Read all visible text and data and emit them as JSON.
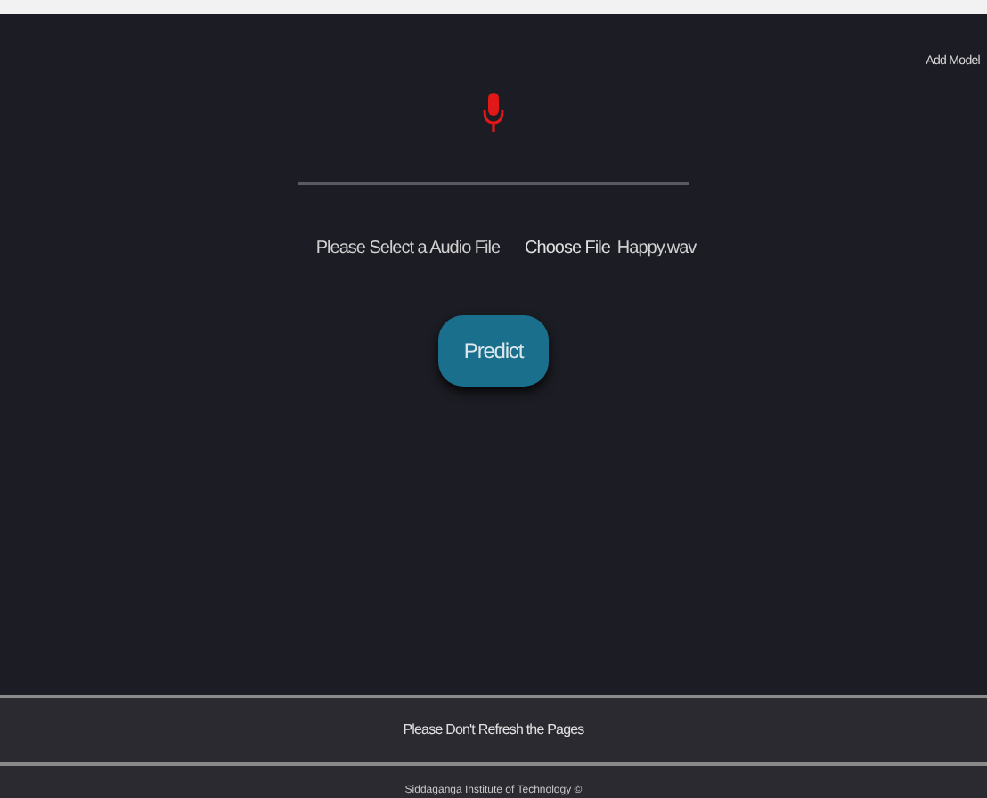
{
  "header": {
    "link": "Add Model"
  },
  "upload": {
    "label": "Please Select a Audio File",
    "button": "Choose File",
    "file_name": "Happy.wav"
  },
  "predict_button": "Predict",
  "notice": "Please Don't Refresh the Pages",
  "footer": "Siddaganga Institute of Technology ©"
}
